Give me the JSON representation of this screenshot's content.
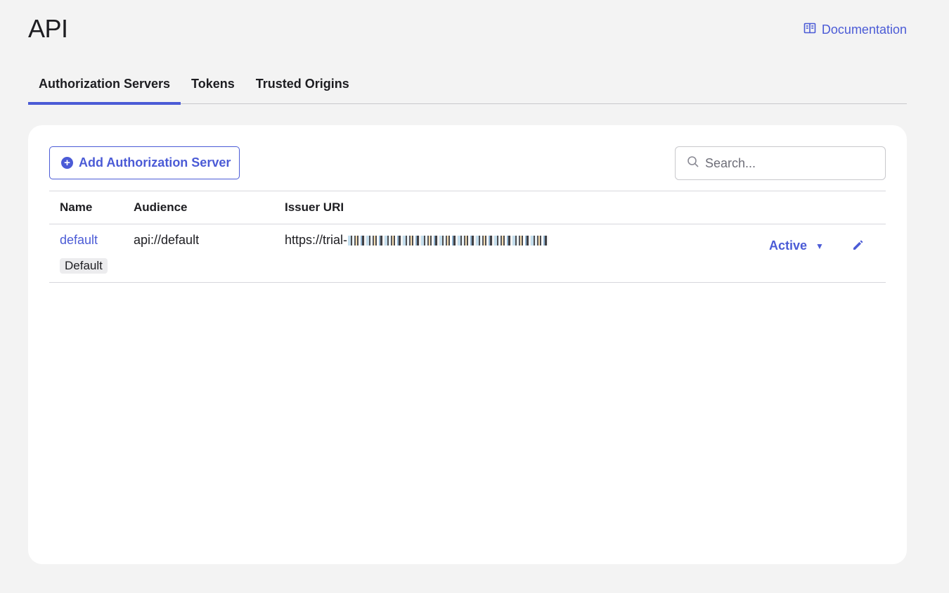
{
  "page": {
    "title": "API"
  },
  "header": {
    "documentation_label": "Documentation"
  },
  "tabs": [
    {
      "label": "Authorization Servers",
      "active": true
    },
    {
      "label": "Tokens",
      "active": false
    },
    {
      "label": "Trusted Origins",
      "active": false
    }
  ],
  "toolbar": {
    "add_label": "Add Authorization Server",
    "search_placeholder": "Search..."
  },
  "table": {
    "columns": [
      "Name",
      "Audience",
      "Issuer URI"
    ],
    "rows": [
      {
        "name": "default",
        "badge": "Default",
        "audience": "api://default",
        "issuer_prefix": "https://trial-",
        "status": "Active"
      }
    ]
  },
  "colors": {
    "accent": "#4b5bd6",
    "background": "#f3f3f3",
    "card": "#ffffff"
  },
  "icons": {
    "documentation": "book-icon",
    "add": "plus-circle-icon",
    "search": "search-icon",
    "status": "caret-down-icon",
    "edit": "pencil-icon"
  }
}
